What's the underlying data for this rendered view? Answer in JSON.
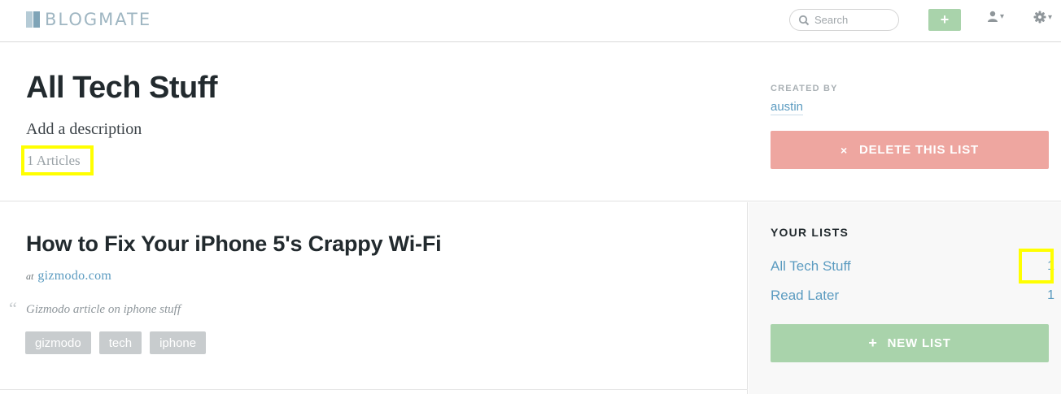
{
  "topbar": {
    "brand": "BLOGMATE",
    "search_placeholder": "Search",
    "add_label": "+",
    "user_chevron": "▾",
    "settings_chevron": "▾"
  },
  "header": {
    "title": "All Tech Stuff",
    "description": "Add a description",
    "article_count": "1 Articles",
    "created_by_label": "CREATED BY",
    "created_by_user": "austin",
    "delete_icon": "×",
    "delete_label": "DELETE THIS LIST"
  },
  "article": {
    "title": "How to Fix Your iPhone 5's Crappy Wi-Fi",
    "source_prefix": "at",
    "source_domain": "gizmodo.com",
    "quote_mark": "“",
    "note": "Gizmodo article on iphone stuff",
    "tags": [
      "gizmodo",
      "tech",
      "iphone"
    ]
  },
  "sidebar": {
    "title": "YOUR LISTS",
    "lists": [
      {
        "name": "All Tech Stuff",
        "count": "1"
      },
      {
        "name": "Read Later",
        "count": "1"
      }
    ],
    "new_list_icon": "+",
    "new_list_label": "NEW LIST"
  },
  "colors": {
    "accent_link": "#5b9bc0",
    "delete_button": "#eea6a0",
    "add_button": "#a9d3ab",
    "highlight": "#ffff00"
  }
}
